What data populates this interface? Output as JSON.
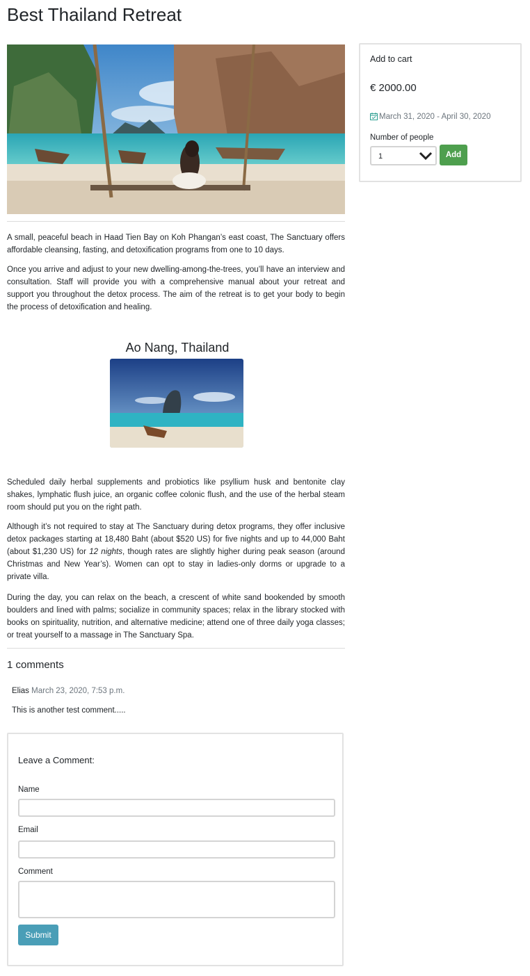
{
  "page": {
    "title": "Best Thailand Retreat"
  },
  "article": {
    "paragraphs_top": [
      "A small, peaceful beach in Haad Tien Bay on Koh Phangan’s east coast, The Sanctuary offers affordable cleansing, fasting, and detoxification programs from one to 10 days.",
      "Once you arrive and adjust to your new dwelling-among-the-trees, you’ll have an interview and consultation. Staff will provide you with a comprehensive manual about your retreat and support you throughout the detox process. The aim of the retreat is to get your body to begin the process of detoxification and healing."
    ],
    "image_caption": "Ao Nang, Thailand",
    "paragraph_3": "Scheduled daily herbal supplements and probiotics like psyllium husk and bentonite clay shakes, lymphatic flush juice, an organic coffee colonic flush, and the use of the herbal steam room should put you on the right path.",
    "paragraph_4_before": "Although it’s not required to stay at The Sanctuary during detox programs, they offer inclusive detox packages starting at 18,480 Baht (about $520 US) for five nights and up to 44,000 Baht (about $1,230 US) for ",
    "paragraph_4_em": "12 nights",
    "paragraph_4_after": ", though rates are slightly higher during peak season (around Christmas and New Year’s). Women can opt to stay in ladies-only dorms or upgrade to a private villa.",
    "paragraph_5": "During the day, you can relax on the beach, a crescent of white sand bookended by smooth boulders and lined with palms; socialize in community spaces; relax in the library stocked with books on spirituality, nutrition, and alternative medicine; attend one of three daily yoga classes; or treat yourself to a massage in The Sanctuary Spa."
  },
  "comments": {
    "heading": "1 comments",
    "items": [
      {
        "author": "Elias",
        "date": "March 23, 2020, 7:53 p.m.",
        "text": "This is another test comment....."
      }
    ]
  },
  "comment_form": {
    "title": "Leave a Comment:",
    "name_label": "Name",
    "email_label": "Email",
    "comment_label": "Comment",
    "submit_label": "Submit"
  },
  "cart": {
    "heading": "Add to cart",
    "price": "€ 2000.00",
    "dates": "March 31, 2020 - April 30, 2020",
    "people_label": "Number of people",
    "people_value": "1",
    "add_label": "Add"
  },
  "colors": {
    "submit": "#4a9eb7",
    "add": "#4e9f4e"
  },
  "icons": [
    "calendar-icon",
    "chevron-down-icon"
  ]
}
